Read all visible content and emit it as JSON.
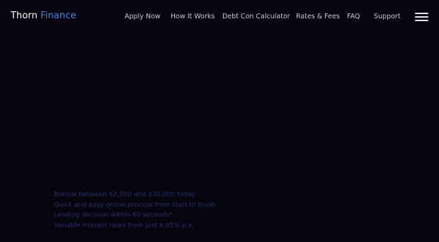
{
  "brand": {
    "name_first": "Thorn",
    "name_second": "Finance"
  },
  "nav": {
    "items": [
      {
        "label": "Apply Now"
      },
      {
        "label": "How It Works"
      },
      {
        "label": "Debt Con Calculator"
      },
      {
        "label": "Rates & Fees"
      },
      {
        "label": "FAQ"
      },
      {
        "label": "Support"
      }
    ]
  },
  "menu": {
    "icon": "hamburger-menu-icon"
  },
  "hero": {
    "features": [
      "Borrow between $2,500 and $30,000 today",
      "Quick and easy online process from start to finish",
      "Lending decision within 60 seconds*",
      "Variable interest rates from just 9.95% p.a."
    ]
  },
  "colors": {
    "background": "#05040f",
    "brand_accent": "#4a86e8",
    "nav_text": "#c9cad3",
    "feature_text": "#2b2f66"
  }
}
